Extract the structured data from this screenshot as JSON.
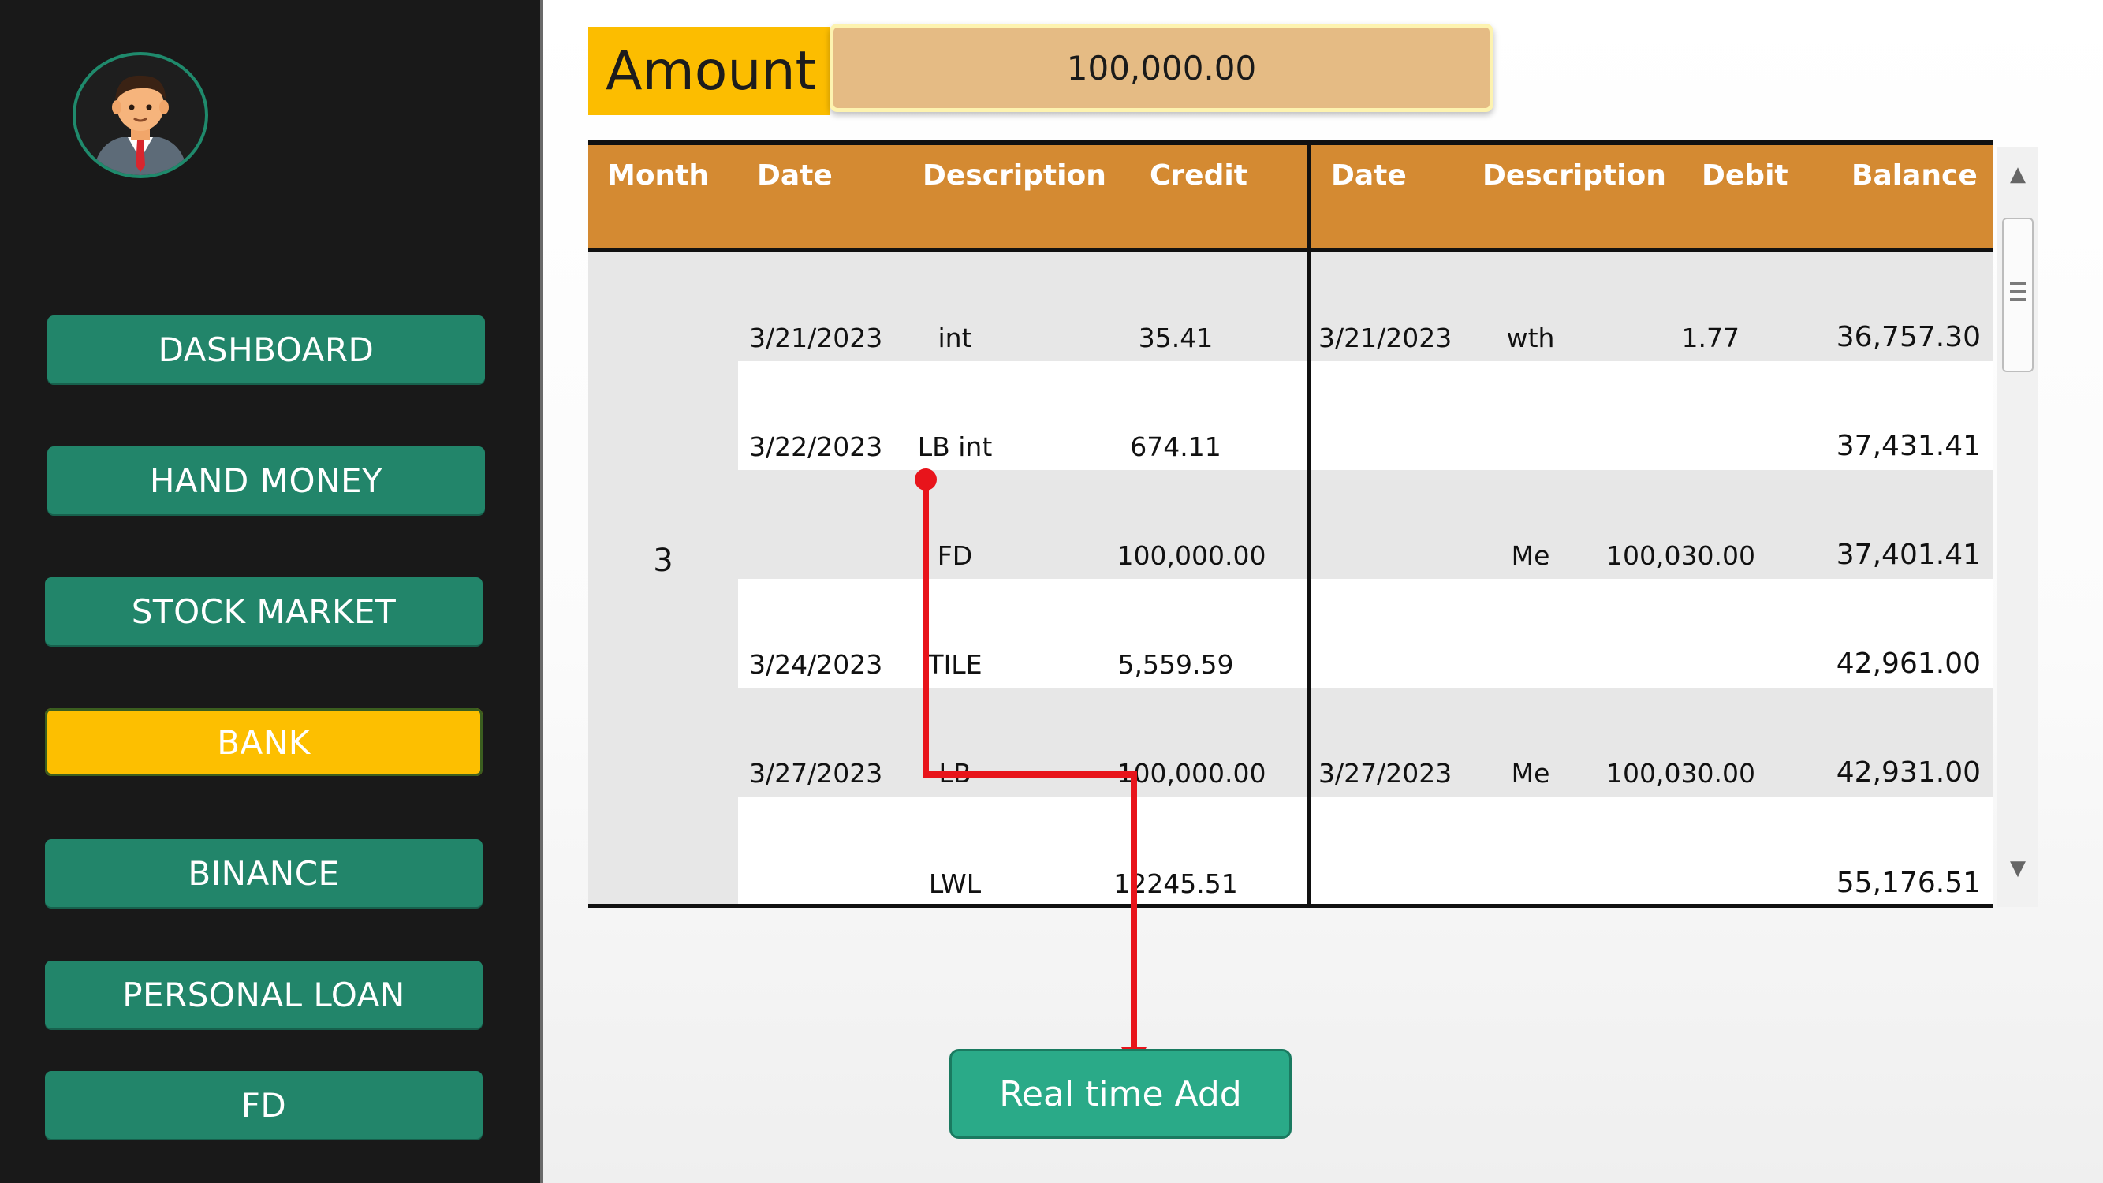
{
  "sidebar": {
    "avatar_icon": "businessman-avatar-icon",
    "items": [
      {
        "label": "DASHBOARD"
      },
      {
        "label": "HAND MONEY"
      },
      {
        "label": "STOCK MARKET"
      },
      {
        "label": "BANK",
        "active": true
      },
      {
        "label": "BINANCE"
      },
      {
        "label": "PERSONAL LOAN"
      },
      {
        "label": "FD"
      }
    ]
  },
  "amount": {
    "label": "Amount",
    "value": "100,000.00"
  },
  "table": {
    "headers": [
      "Month",
      "Date",
      "Description",
      "Credit",
      "Date",
      "Description",
      "Debit",
      "Balance"
    ],
    "month": "3",
    "rows": [
      {
        "credit_date": "3/21/2023",
        "credit_desc": "int",
        "credit": "35.41",
        "debit_date": "3/21/2023",
        "debit_desc": "wth",
        "debit": "1.77",
        "balance": "36,757.30"
      },
      {
        "credit_date": "3/22/2023",
        "credit_desc": "LB int",
        "credit": "674.11",
        "debit_date": "",
        "debit_desc": "",
        "debit": "",
        "balance": "37,431.41"
      },
      {
        "credit_date": "",
        "credit_desc": "FD",
        "credit": "100,000.00",
        "debit_date": "",
        "debit_desc": "Me",
        "debit": "100,030.00",
        "balance": "37,401.41"
      },
      {
        "credit_date": "3/24/2023",
        "credit_desc": "TILE",
        "credit": "5,559.59",
        "debit_date": "",
        "debit_desc": "",
        "debit": "",
        "balance": "42,961.00"
      },
      {
        "credit_date": "3/27/2023",
        "credit_desc": "LB",
        "credit": "100,000.00",
        "debit_date": "3/27/2023",
        "debit_desc": "Me",
        "debit": "100,030.00",
        "balance": "42,931.00"
      },
      {
        "credit_date": "",
        "credit_desc": "LWL",
        "credit": "12245.51",
        "debit_date": "",
        "debit_desc": "",
        "debit": "",
        "balance": "55,176.51"
      }
    ]
  },
  "realtime_button": {
    "label": "Real time Add"
  },
  "colors": {
    "sidebar_bg": "#191919",
    "nav_button": "#22856a",
    "nav_active": "#fdbf00",
    "amount_label_bg": "#fcbd00",
    "amount_input_bg": "#e5bb84",
    "table_header": "#d48a32",
    "row_shade": "#e7e7e7",
    "action_button": "#2aaa88",
    "annotation_arrow": "#e8141b"
  }
}
